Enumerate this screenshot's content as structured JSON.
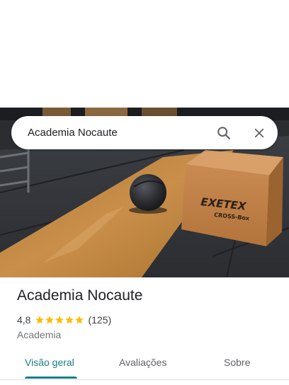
{
  "search": {
    "query": "Academia Nocaute",
    "search_icon": "search-icon",
    "close_icon": "close-icon"
  },
  "hero_photo": {
    "brand_text": "EXETEX",
    "brand_subtext": "CROSS-Box"
  },
  "place": {
    "name": "Academia Nocaute",
    "rating": "4,8",
    "stars": 5,
    "star_color": "#fbbc04",
    "review_count": "(125)",
    "category": "Academia"
  },
  "tabs": [
    {
      "label": "Visão geral",
      "active": true
    },
    {
      "label": "Avaliações",
      "active": false
    },
    {
      "label": "Sobre",
      "active": false
    }
  ],
  "colors": {
    "accent": "#1a7f86"
  }
}
